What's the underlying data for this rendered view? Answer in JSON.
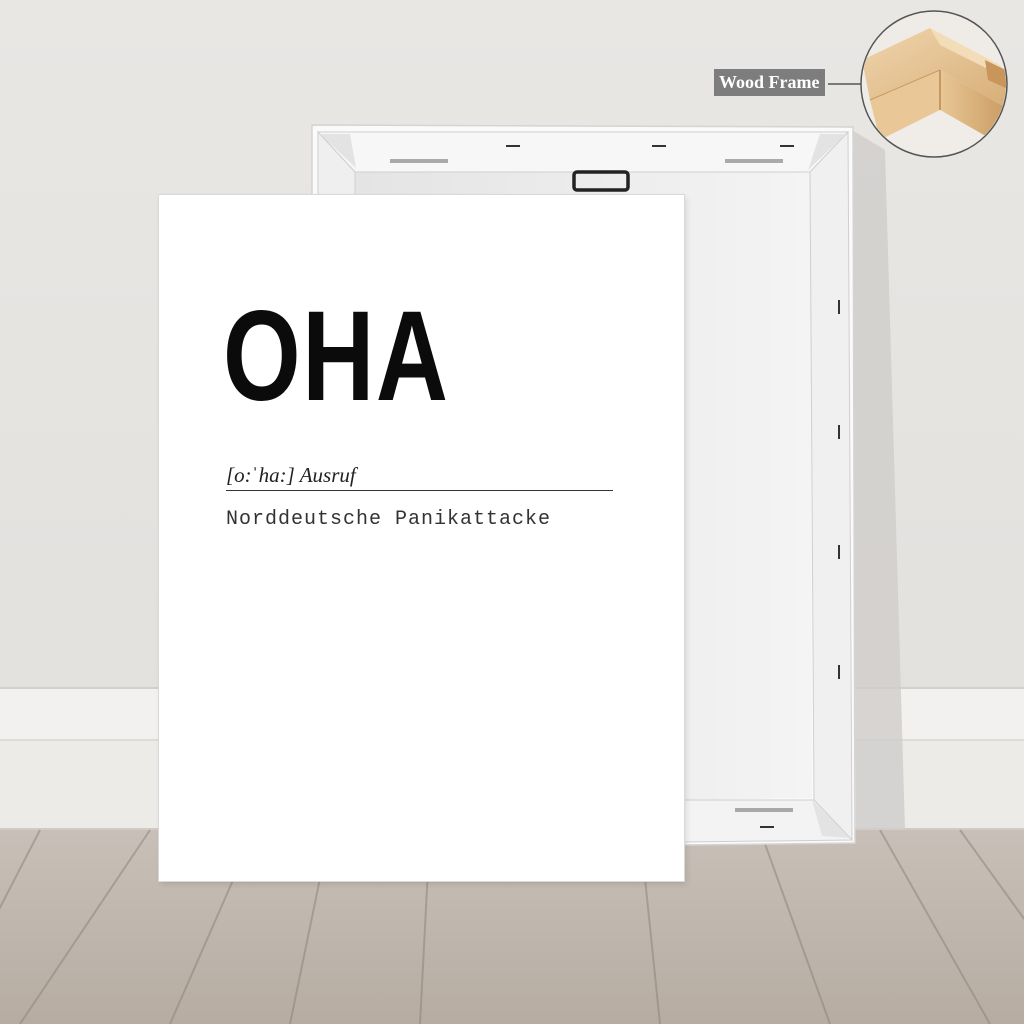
{
  "badge": {
    "label": "Wood Frame"
  },
  "poster": {
    "word": "OHA",
    "phonetic": "[o:ˈha:] Ausruf",
    "definition": "Norddeutsche Panikattacke"
  },
  "colors": {
    "wall": "#e7e5e2",
    "floor": "#bfb6ad",
    "canvas": "#ffffff",
    "wood": "#dcb98a",
    "text": "#0b0b0b"
  }
}
